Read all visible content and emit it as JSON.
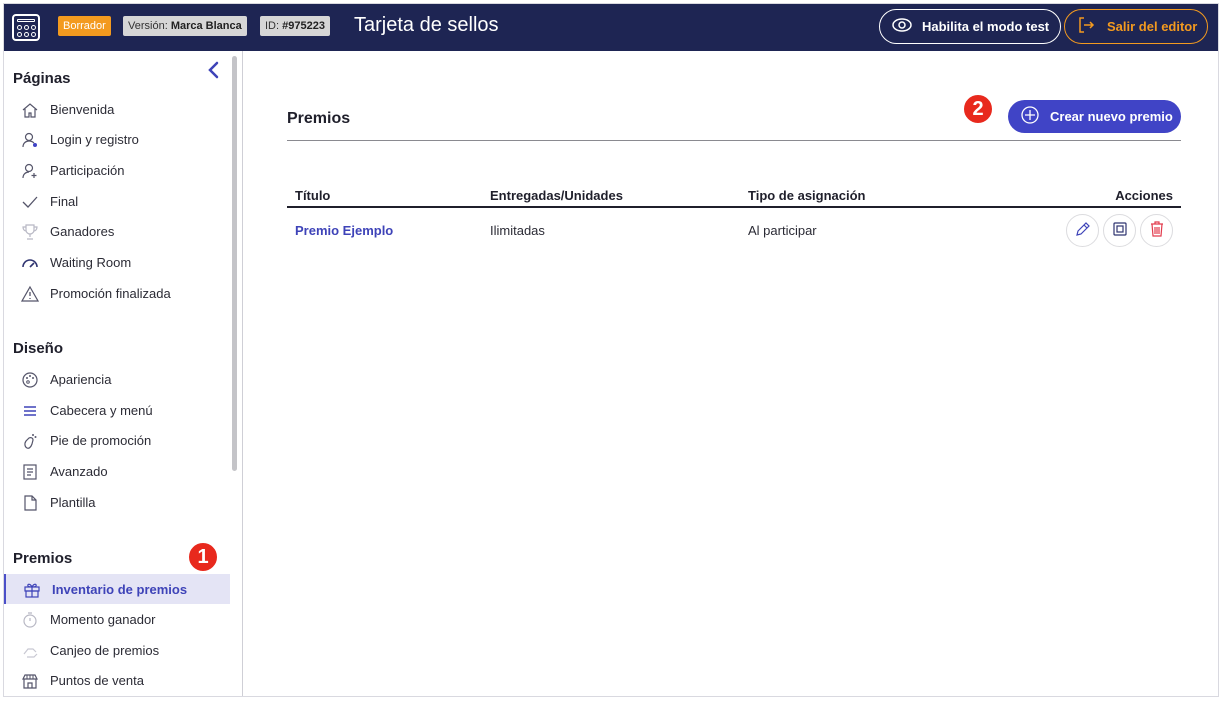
{
  "header": {
    "status_badge": "Borrador",
    "version_label": "Versión:",
    "version_value": "Marca Blanca",
    "id_label": "ID:",
    "id_value": "#975223",
    "title": "Tarjeta de sellos",
    "test_mode_button": "Habilita el modo test",
    "exit_button": "Salir del editor"
  },
  "sidebar": {
    "sections": [
      {
        "title": "Páginas"
      },
      {
        "title": "Diseño"
      },
      {
        "title": "Premios"
      }
    ],
    "pages": [
      {
        "label": "Bienvenida",
        "icon": "home-icon"
      },
      {
        "label": "Login y registro",
        "icon": "user-icon"
      },
      {
        "label": "Participación",
        "icon": "user-add-icon"
      },
      {
        "label": "Final",
        "icon": "check-icon"
      },
      {
        "label": "Ganadores",
        "icon": "trophy-icon"
      },
      {
        "label": "Waiting Room",
        "icon": "gauge-icon"
      },
      {
        "label": "Promoción finalizada",
        "icon": "warning-icon"
      }
    ],
    "design": [
      {
        "label": "Apariencia",
        "icon": "palette-icon"
      },
      {
        "label": "Cabecera y menú",
        "icon": "menu-icon"
      },
      {
        "label": "Pie de promoción",
        "icon": "footprint-icon"
      },
      {
        "label": "Avanzado",
        "icon": "document-icon"
      },
      {
        "label": "Plantilla",
        "icon": "page-icon"
      }
    ],
    "prizes": [
      {
        "label": "Inventario de premios",
        "icon": "gift-icon",
        "active": true
      },
      {
        "label": "Momento ganador",
        "icon": "stopwatch-icon"
      },
      {
        "label": "Canjeo de premios",
        "icon": "hand-icon"
      },
      {
        "label": "Puntos de venta",
        "icon": "store-icon"
      }
    ]
  },
  "main": {
    "title": "Premios",
    "create_button": "Crear nuevo premio",
    "table": {
      "headers": [
        "Título",
        "Entregadas/Unidades",
        "Tipo de asignación",
        "Acciones"
      ],
      "rows": [
        {
          "title": "Premio Ejemplo",
          "units": "Ilimitadas",
          "assignment": "Al participar"
        }
      ]
    }
  },
  "annotations": {
    "step1": "1",
    "step2": "2"
  },
  "colors": {
    "topbar": "#1e2553",
    "accent": "#4044c6",
    "draft": "#f39a1f",
    "marker": "#e8291d"
  }
}
